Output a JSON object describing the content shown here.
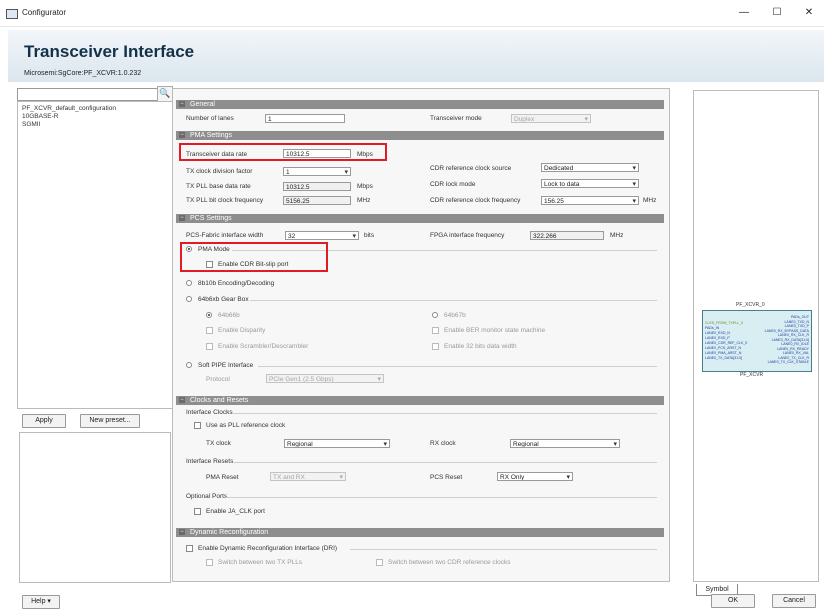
{
  "window": {
    "title": "Configurator",
    "minimize": "—",
    "maximize": "☐",
    "close": "✕"
  },
  "header": {
    "title": "Transceiver Interface",
    "subtitle": "Microsemi:SgCore:PF_XCVR:1.0.232"
  },
  "presets": {
    "search_value": "",
    "items": [
      "PF_XCVR_default_configuration",
      "10GBASE-R",
      "SGMII"
    ],
    "apply_label": "Apply",
    "new_preset_label": "New preset..."
  },
  "general": {
    "title": "General",
    "num_lanes_label": "Number of lanes",
    "num_lanes_value": "1",
    "mode_label": "Transceiver mode",
    "mode_value": "Duplex"
  },
  "pma": {
    "title": "PMA Settings",
    "rate_label": "Transceiver data rate",
    "rate_value": "10312.5",
    "rate_unit": "Mbps",
    "tx_div_label": "TX clock division factor",
    "tx_div_value": "1",
    "pll_rate_label": "TX PLL base data rate",
    "pll_rate_value": "10312.5",
    "pll_rate_unit": "Mbps",
    "pll_clk_label": "TX PLL bit clock frequency",
    "pll_clk_value": "5156.25",
    "pll_clk_unit": "MHz",
    "cdr_src_label": "CDR reference clock source",
    "cdr_src_value": "Dedicated",
    "cdr_lock_label": "CDR lock mode",
    "cdr_lock_value": "Lock to data",
    "cdr_freq_label": "CDR reference clock frequency",
    "cdr_freq_value": "156.25",
    "cdr_freq_unit": "MHz"
  },
  "pcs": {
    "title": "PCS Settings",
    "width_label": "PCS-Fabric interface width",
    "width_value": "32",
    "width_unit": "bits",
    "fpga_freq_label": "FPGA interface frequency",
    "fpga_freq_value": "322.266",
    "fpga_freq_unit": "MHz",
    "pma_mode": "PMA Mode",
    "cdr_bitslip": "Enable CDR Bit-slip port",
    "enc_8b10b": "8b10b Encoding/Decoding",
    "gearbox": "64b6xb Gear Box",
    "g66": "64b66b",
    "g67": "64b67b",
    "disparity": "Enable Disparity",
    "ber": "Enable BER monitor state machine",
    "scrambler": "Enable Scrambler/Descrambler",
    "width32": "Enable 32 bits data width",
    "pipe": "Soft PIPE Interface",
    "protocol_label": "Protocol",
    "protocol_value": "PCIe Gen1 (2.5 Gbps)"
  },
  "clocks": {
    "title": "Clocks and Resets",
    "iface_clocks": "Interface Clocks",
    "use_pll": "Use as PLL reference clock",
    "tx_label": "TX clock",
    "tx_value": "Regional",
    "rx_label": "RX clock",
    "rx_value": "Regional",
    "iface_resets": "Interface Resets",
    "pma_reset_label": "PMA Reset",
    "pma_reset_value": "TX and RX",
    "pcs_reset_label": "PCS Reset",
    "pcs_reset_value": "RX Only",
    "optional_ports": "Optional Ports",
    "ja_clk": "Enable JA_CLK port"
  },
  "dri": {
    "title": "Dynamic Reconfiguration",
    "enable": "Enable Dynamic Reconfiguration Interface (DRI)",
    "switch_tx": "Switch between two TX PLLs",
    "switch_cdr": "Switch between two CDR reference clocks"
  },
  "symbol": {
    "tab": "Symbol",
    "top_name": "PF_XCVR_0",
    "bottom_name": "PF_XCVR",
    "left_pins": [
      "CLKS_FROM_TXPLL_0",
      "PADs_IN",
      "LANE0_RXD_N",
      "LANE0_RXD_P",
      "LANE0_CDR_REF_CLK_0",
      "LANE0_PCS_ARST_N",
      "LANE0_PMA_ARST_N",
      "LANE0_TX_DATA[31:0]"
    ],
    "right_pins": [
      "PADs_OUT",
      "LANE0_TXD_N",
      "LANE0_TXD_P",
      "LANE0_RX_BYPASS_DATA",
      "LANE0_RX_CLK_R",
      "LANE0_RX_DATA[31:0]",
      "LANE0_RX_IDLE",
      "LANE0_RX_READY",
      "LANE0_RX_VAL",
      "LANE0_TX_CLK_R",
      "LANE0_TX_CLK_STABLE"
    ]
  },
  "footer": {
    "help": "Help",
    "ok": "OK",
    "cancel": "Cancel"
  }
}
